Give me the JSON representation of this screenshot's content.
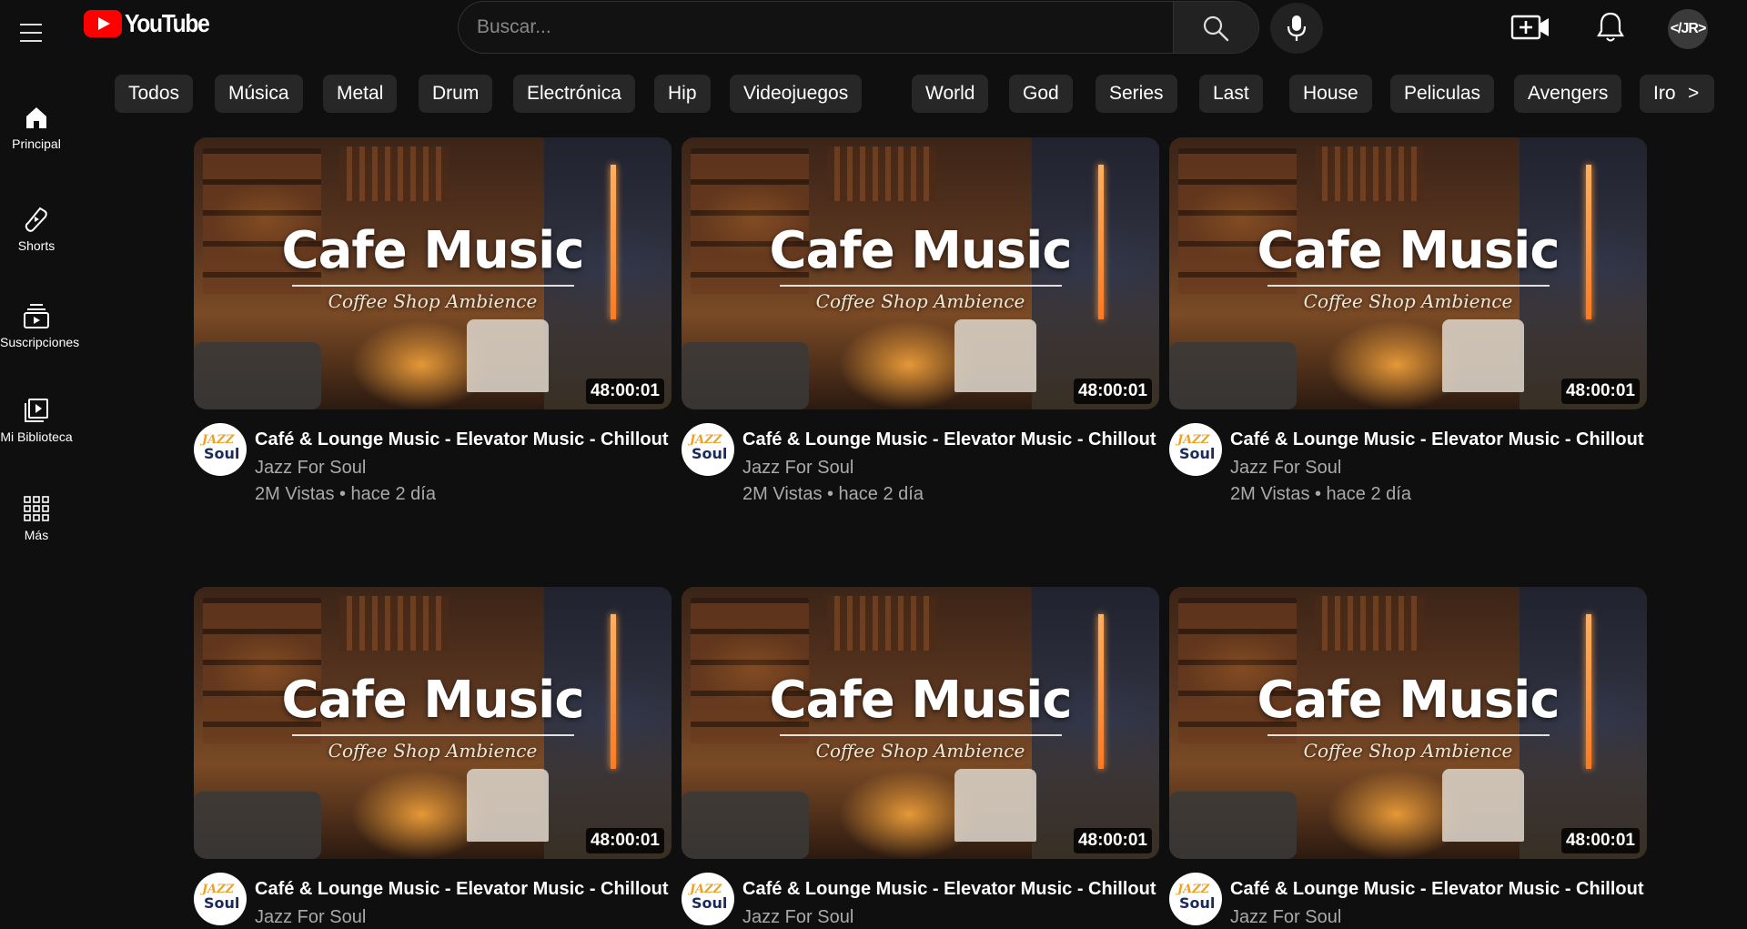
{
  "header": {
    "logo_text": "YouTube",
    "search_placeholder": "Buscar...",
    "user_avatar_text": "</JR>"
  },
  "sidebar": {
    "items": [
      {
        "label": "Principal",
        "icon": "home-icon"
      },
      {
        "label": "Shorts",
        "icon": "shorts-icon"
      },
      {
        "label": "Suscripciones",
        "icon": "subscriptions-icon"
      },
      {
        "label": "Mi Biblioteca",
        "icon": "library-icon"
      },
      {
        "label": "Más",
        "icon": "grid-icon"
      }
    ]
  },
  "chips": [
    "Todos",
    "Música",
    "Metal",
    "Drum",
    "Electrónica",
    "Hip",
    "Videojuegos",
    "World",
    "God",
    "Series",
    "Last",
    "House",
    "Peliculas",
    "Avengers",
    "Iron",
    ">"
  ],
  "videos": [
    {
      "thumb_title": "Cafe Music",
      "thumb_subtitle": "Coffee Shop Ambience",
      "duration": "48:00:01",
      "title": "Café & Lounge Music - Elevator Music - Chillout",
      "channel": "Jazz For Soul",
      "stats": "2M Vistas • hace 2 día",
      "avatar_top": "JAZZ",
      "avatar_bottom": "Soul"
    },
    {
      "thumb_title": "Cafe Music",
      "thumb_subtitle": "Coffee Shop Ambience",
      "duration": "48:00:01",
      "title": "Café & Lounge Music - Elevator Music - Chillout",
      "channel": "Jazz For Soul",
      "stats": "2M Vistas • hace 2 día",
      "avatar_top": "JAZZ",
      "avatar_bottom": "Soul"
    },
    {
      "thumb_title": "Cafe Music",
      "thumb_subtitle": "Coffee Shop Ambience",
      "duration": "48:00:01",
      "title": "Café & Lounge Music - Elevator Music - Chillout",
      "channel": "Jazz For Soul",
      "stats": "2M Vistas • hace 2 día",
      "avatar_top": "JAZZ",
      "avatar_bottom": "Soul"
    },
    {
      "thumb_title": "Cafe Music",
      "thumb_subtitle": "Coffee Shop Ambience",
      "duration": "48:00:01",
      "title": "Café & Lounge Music - Elevator Music - Chillout",
      "channel": "Jazz For Soul",
      "stats": "",
      "avatar_top": "JAZZ",
      "avatar_bottom": "Soul"
    },
    {
      "thumb_title": "Cafe Music",
      "thumb_subtitle": "Coffee Shop Ambience",
      "duration": "48:00:01",
      "title": "Café & Lounge Music - Elevator Music - Chillout",
      "channel": "Jazz For Soul",
      "stats": "",
      "avatar_top": "JAZZ",
      "avatar_bottom": "Soul"
    },
    {
      "thumb_title": "Cafe Music",
      "thumb_subtitle": "Coffee Shop Ambience",
      "duration": "48:00:01",
      "title": "Café & Lounge Music - Elevator Music - Chillout",
      "channel": "Jazz For Soul",
      "stats": "",
      "avatar_top": "JAZZ",
      "avatar_bottom": "Soul"
    }
  ],
  "colors": {
    "brand": "#ff0000",
    "background": "#0f0f0f",
    "chip": "#272727"
  }
}
